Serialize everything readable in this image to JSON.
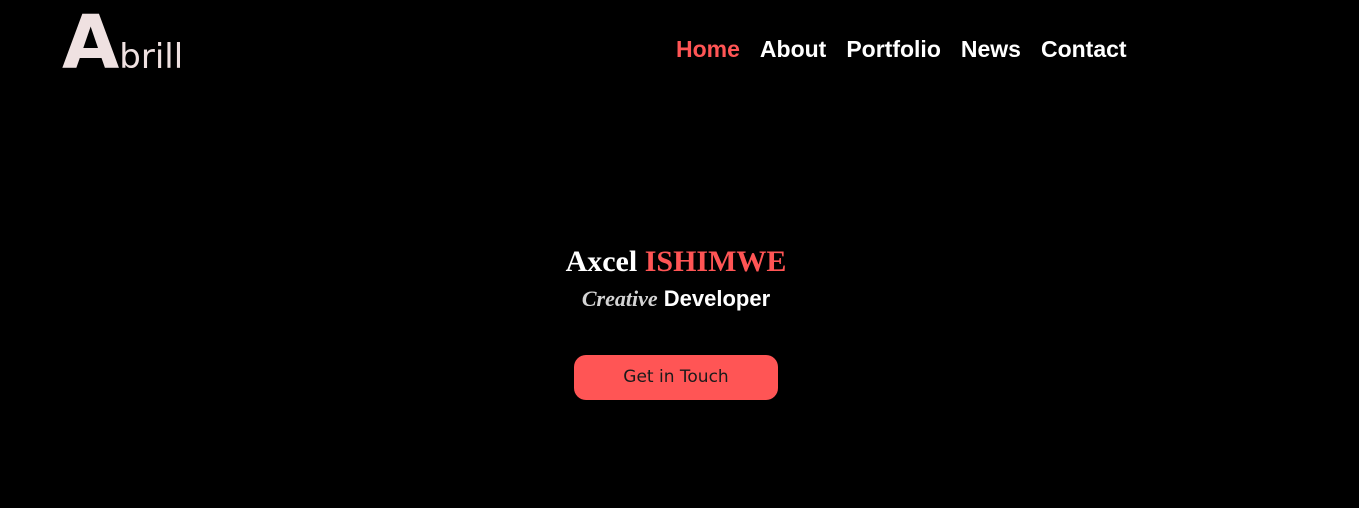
{
  "brand": {
    "logo_initial": "A",
    "logo_rest": "brill"
  },
  "nav": {
    "items": [
      {
        "label": "Home",
        "active": true
      },
      {
        "label": "About",
        "active": false
      },
      {
        "label": "Portfolio",
        "active": false
      },
      {
        "label": "News",
        "active": false
      },
      {
        "label": "Contact",
        "active": false
      }
    ]
  },
  "hero": {
    "first_name": "Axcel",
    "last_name": "ISHIMWE",
    "role_prefix": "Creative",
    "role_main": "Developer",
    "cta_label": "Get in Touch"
  },
  "colors": {
    "background": "#000000",
    "accent": "#ff5555",
    "text": "#ffffff",
    "logo": "#efe1e1"
  }
}
